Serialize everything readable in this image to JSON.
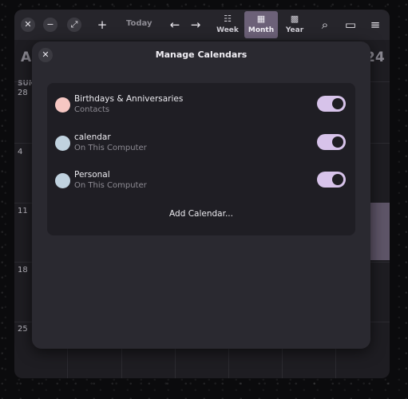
{
  "header": {
    "today_label": "Today",
    "views": [
      {
        "label": "Week",
        "icon": "week-icon",
        "active": false
      },
      {
        "label": "Month",
        "icon": "month-icon",
        "active": true
      },
      {
        "label": "Year",
        "icon": "year-icon",
        "active": false
      }
    ]
  },
  "calendar": {
    "month_title_partial": "A",
    "year_title_partial": "24",
    "day_header_partial": "SUN",
    "week_numbers": [
      "28",
      "4",
      "11",
      "18",
      "25"
    ]
  },
  "dialog": {
    "title": "Manage Calendars",
    "calendars": [
      {
        "name": "Birthdays & Anniversaries",
        "source": "Contacts",
        "color": "#f6c7c3",
        "enabled": true
      },
      {
        "name": "calendar",
        "source": "On This Computer",
        "color": "#c0d2df",
        "enabled": true
      },
      {
        "name": "Personal",
        "source": "On This Computer",
        "color": "#c0d2df",
        "enabled": true
      }
    ],
    "add_label": "Add Calendar..."
  },
  "colors": {
    "accent": "#d7c3ea",
    "active_view": "#6c6178"
  }
}
